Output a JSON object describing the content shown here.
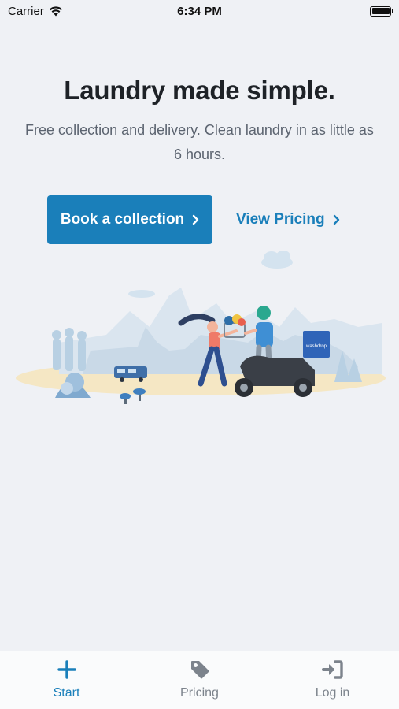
{
  "status_bar": {
    "carrier": "Carrier",
    "time": "6:34 PM"
  },
  "hero": {
    "title": "Laundry made simple.",
    "subtitle": "Free collection and delivery. Clean laundry in as little as 6 hours."
  },
  "actions": {
    "book_label": "Book a collection",
    "pricing_label": "View Pricing"
  },
  "illustration": {
    "box_text": "washdrop"
  },
  "tabs": [
    {
      "label": "Start",
      "icon": "plus-icon",
      "active": true
    },
    {
      "label": "Pricing",
      "icon": "tag-icon",
      "active": false
    },
    {
      "label": "Log in",
      "icon": "login-icon",
      "active": false
    }
  ],
  "colors": {
    "accent": "#1a7fba",
    "background": "#eff1f5",
    "tab_inactive": "#7c838c"
  }
}
